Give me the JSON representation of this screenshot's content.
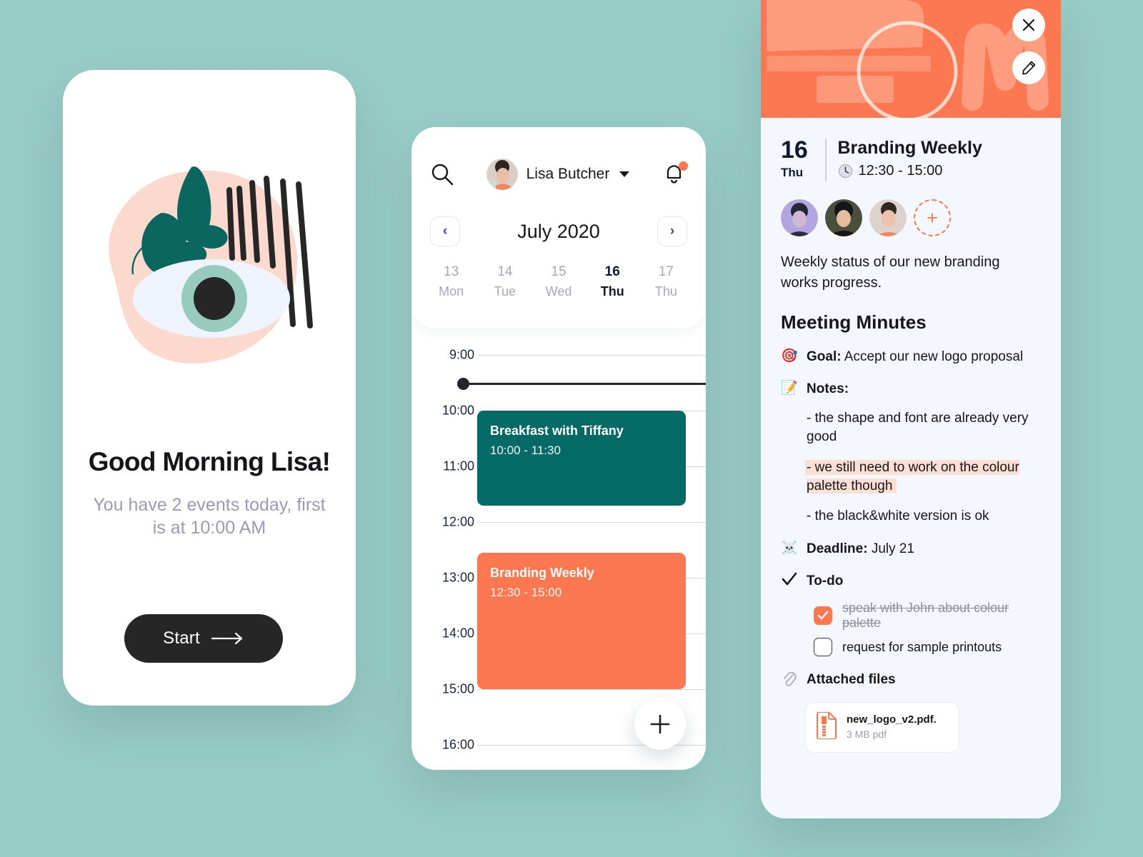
{
  "theme": {
    "page_bg": "#98ccc6",
    "orange": "#fc7850",
    "teal": "#056a65",
    "dark": "#262626",
    "panel_bg": "#f5f7fe",
    "highlight": "#fde0d3",
    "muted": "#9b9ab4"
  },
  "welcome": {
    "title": "Good Morning Lisa!",
    "subtitle": "You have 2 events today, first is at 10:00 AM",
    "start_label": "Start",
    "arrow_icon": "arrow-right-icon",
    "illustration": "abstract-eye-plant-illustration"
  },
  "calendar": {
    "search_icon": "search-icon",
    "user_name": "Lisa Butcher",
    "user_caret_icon": "chevron-down-icon",
    "avatar_icon": "user-avatar",
    "bell_icon": "bell-icon",
    "has_notification": true,
    "prev_label": "‹",
    "next_label": "›",
    "month": "July 2020",
    "days": [
      {
        "num": "13",
        "name": "Mon",
        "active": false
      },
      {
        "num": "14",
        "name": "Tue",
        "active": false
      },
      {
        "num": "15",
        "name": "Wed",
        "active": false
      },
      {
        "num": "16",
        "name": "Thu",
        "active": true
      },
      {
        "num": "17",
        "name": "Thu",
        "active": false
      }
    ],
    "hours": [
      "9:00",
      "10:00",
      "11:00",
      "12:00",
      "13:00",
      "14:00",
      "15:00",
      "16:00"
    ],
    "current_time_marker": true,
    "events": [
      {
        "title": "Breakfast with Tiffany",
        "time": "10:00 - 11:30",
        "color": "#056a65"
      },
      {
        "title": "Branding Weekly",
        "time": "12:30 - 15:00",
        "color": "#fc7850"
      }
    ],
    "add_event_label": "+",
    "add_event_icon": "plus-icon"
  },
  "detail": {
    "close_icon": "close-icon",
    "edit_icon": "pencil-icon",
    "banner_icon": "abstract-banner-graphic",
    "day_num": "16",
    "day_name": "Thu",
    "event_title": "Branding Weekly",
    "clock_icon": "clock-icon",
    "event_time": "12:30 - 15:00",
    "attendees_count": 3,
    "add_attendee_label": "+",
    "description": "Weekly status of our new branding works progress.",
    "minutes_title": "Meeting Minutes",
    "goal_icon": "🎯",
    "goal_label": "Goal:",
    "goal_text": "Accept our new logo proposal",
    "notes_icon": "📝",
    "notes_label": "Notes:",
    "notes": [
      {
        "text": "- the shape and font are already very good",
        "highlighted": false
      },
      {
        "text": "- we still need to work on the colour palette though",
        "highlighted": true
      },
      {
        "text": "- the black&white version is ok",
        "highlighted": false
      }
    ],
    "deadline_icon": "☠️",
    "deadline_label": "Deadline:",
    "deadline_text": "July 21",
    "todo_icon": "check-icon",
    "todo_label": "To-do",
    "todos": [
      {
        "label": "speak with John about colour palette",
        "done": true
      },
      {
        "label": "request for sample printouts",
        "done": false
      }
    ],
    "attached_icon": "paperclip-icon",
    "attached_label": "Attached files",
    "files": [
      {
        "name": "new_logo_v2.pdf.",
        "meta": "3 MB pdf",
        "icon": "pdf-file-icon"
      }
    ]
  }
}
